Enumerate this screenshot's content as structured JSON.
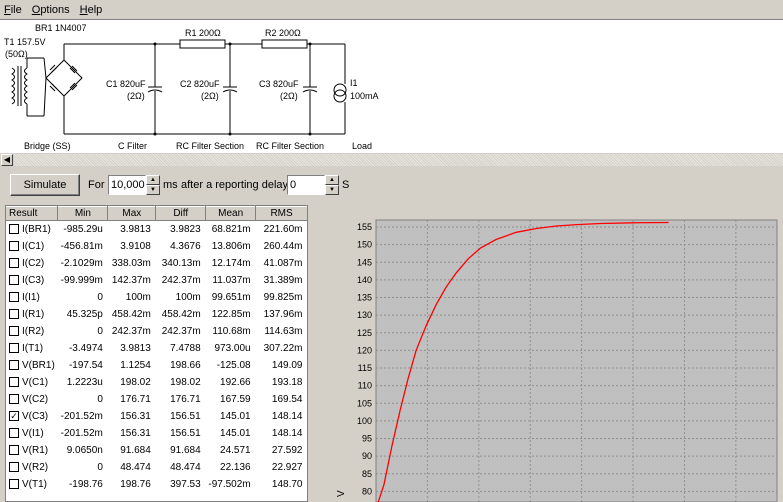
{
  "menu": [
    {
      "label": "File",
      "hot": "F",
      "rest": "ile"
    },
    {
      "label": "Options",
      "hot": "O",
      "rest": "ptions"
    },
    {
      "label": "Help",
      "hot": "H",
      "rest": "elp"
    }
  ],
  "schematic": {
    "transformer": "T1 157.5V",
    "transformer_r": "(50Ω)",
    "bridge": "BR1 1N4007",
    "r1": "R1 200Ω",
    "r2": "R2 200Ω",
    "c1": "C1 820uF",
    "c1_r": "(2Ω)",
    "c2": "C2 820uF",
    "c2_r": "(2Ω)",
    "c3": "C3 820uF",
    "c3_r": "(2Ω)",
    "i1": "I1",
    "i1_val": "100mA",
    "sections": [
      "Bridge (SS)",
      "C Filter",
      "RC Filter Section",
      "RC Filter Section",
      "Load"
    ]
  },
  "controls": {
    "simulate_label": "Simulate",
    "for_label": "For",
    "duration_value": "10,000",
    "ms_label": "ms",
    "after_label": "after a reporting delay of",
    "delay_value": "0",
    "s_label": "S"
  },
  "results": {
    "headers": [
      "Result",
      "Min",
      "Max",
      "Diff",
      "Mean",
      "RMS"
    ],
    "rows": [
      {
        "name": "I(BR1)",
        "checked": false,
        "min": "-985.29u",
        "max": "3.9813",
        "diff": "3.9823",
        "mean": "68.821m",
        "rms": "221.60m"
      },
      {
        "name": "I(C1)",
        "checked": false,
        "min": "-456.81m",
        "max": "3.9108",
        "diff": "4.3676",
        "mean": "13.806m",
        "rms": "260.44m"
      },
      {
        "name": "I(C2)",
        "checked": false,
        "min": "-2.1029m",
        "max": "338.03m",
        "diff": "340.13m",
        "mean": "12.174m",
        "rms": "41.087m"
      },
      {
        "name": "I(C3)",
        "checked": false,
        "min": "-99.999m",
        "max": "142.37m",
        "diff": "242.37m",
        "mean": "11.037m",
        "rms": "31.389m"
      },
      {
        "name": "I(I1)",
        "checked": false,
        "min": "0",
        "max": "100m",
        "diff": "100m",
        "mean": "99.651m",
        "rms": "99.825m"
      },
      {
        "name": "I(R1)",
        "checked": false,
        "min": "45.325p",
        "max": "458.42m",
        "diff": "458.42m",
        "mean": "122.85m",
        "rms": "137.96m"
      },
      {
        "name": "I(R2)",
        "checked": false,
        "min": "0",
        "max": "242.37m",
        "diff": "242.37m",
        "mean": "110.68m",
        "rms": "114.63m"
      },
      {
        "name": "I(T1)",
        "checked": false,
        "min": "-3.4974",
        "max": "3.9813",
        "diff": "7.4788",
        "mean": "973.00u",
        "rms": "307.22m"
      },
      {
        "name": "V(BR1)",
        "checked": false,
        "min": "-197.54",
        "max": "1.1254",
        "diff": "198.66",
        "mean": "-125.08",
        "rms": "149.09"
      },
      {
        "name": "V(C1)",
        "checked": false,
        "min": "1.2223u",
        "max": "198.02",
        "diff": "198.02",
        "mean": "192.66",
        "rms": "193.18"
      },
      {
        "name": "V(C2)",
        "checked": false,
        "min": "0",
        "max": "176.71",
        "diff": "176.71",
        "mean": "167.59",
        "rms": "169.54"
      },
      {
        "name": "V(C3)",
        "checked": true,
        "min": "-201.52m",
        "max": "156.31",
        "diff": "156.51",
        "mean": "145.01",
        "rms": "148.14"
      },
      {
        "name": "V(I1)",
        "checked": false,
        "min": "-201.52m",
        "max": "156.31",
        "diff": "156.51",
        "mean": "145.01",
        "rms": "148.14"
      },
      {
        "name": "V(R1)",
        "checked": false,
        "min": "9.0650n",
        "max": "91.684",
        "diff": "91.684",
        "mean": "24.571",
        "rms": "27.592"
      },
      {
        "name": "V(R2)",
        "checked": false,
        "min": "0",
        "max": "48.474",
        "diff": "48.474",
        "mean": "22.136",
        "rms": "22.927"
      },
      {
        "name": "V(T1)",
        "checked": false,
        "min": "-198.76",
        "max": "198.76",
        "diff": "397.53",
        "mean": "-97.502m",
        "rms": "148.70"
      }
    ]
  },
  "chart_data": {
    "type": "line",
    "title": "",
    "xlabel": "",
    "ylabel": "V",
    "yticks": [
      155,
      150,
      145,
      140,
      135,
      130,
      125,
      120,
      115,
      110,
      105,
      100,
      95,
      90,
      85,
      80
    ],
    "ylim": [
      77,
      157
    ],
    "grid": true,
    "series": [
      {
        "color": "#ff0000",
        "points": [
          [
            0.0,
            75
          ],
          [
            0.02,
            82
          ],
          [
            0.04,
            93
          ],
          [
            0.06,
            103
          ],
          [
            0.08,
            112
          ],
          [
            0.1,
            120
          ],
          [
            0.125,
            127
          ],
          [
            0.15,
            133
          ],
          [
            0.175,
            138
          ],
          [
            0.2,
            142
          ],
          [
            0.23,
            146
          ],
          [
            0.26,
            149
          ],
          [
            0.3,
            151.5
          ],
          [
            0.35,
            153.5
          ],
          [
            0.4,
            154.6
          ],
          [
            0.45,
            155.3
          ],
          [
            0.5,
            155.7
          ],
          [
            0.56,
            156.0
          ],
          [
            0.64,
            156.2
          ],
          [
            0.73,
            156.3
          ]
        ]
      }
    ]
  }
}
